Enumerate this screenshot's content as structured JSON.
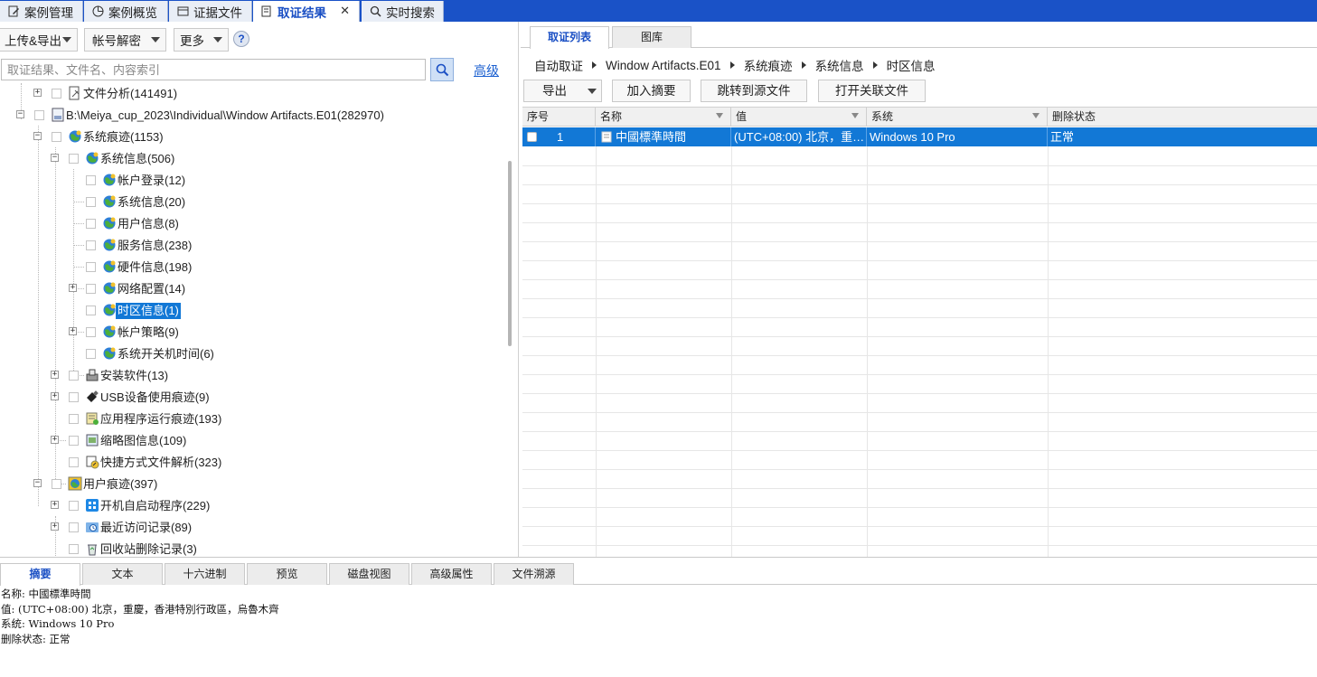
{
  "top_tabs": [
    {
      "label": "案例管理",
      "icon": "edit-icon"
    },
    {
      "label": "案例概览",
      "icon": "pie-chart-icon"
    },
    {
      "label": "证据文件",
      "icon": "document-icon"
    },
    {
      "label": "取证结果",
      "icon": "result-list-icon",
      "active": true,
      "closable": true
    },
    {
      "label": "实时搜索",
      "icon": "search-icon"
    }
  ],
  "left_toolbar": {
    "upload_export": "上传&导出",
    "account_decrypt": "帐号解密",
    "more": "更多",
    "help": "?"
  },
  "search": {
    "placeholder": "取证结果、文件名、内容索引",
    "advanced": "高级"
  },
  "tree": [
    {
      "label": "文件分析(141491)",
      "icon": "file-analysis-icon"
    },
    {
      "label": "B:\\Meiya_cup_2023\\Individual\\Window Artifacts.E01(282970)",
      "icon": "disk-image-icon"
    },
    {
      "label": "系统痕迹(1153)",
      "icon": "globe-icon"
    },
    {
      "label": "系统信息(506)",
      "icon": "globe-icon"
    },
    {
      "label": "帐户登录(12)",
      "icon": "globe-icon"
    },
    {
      "label": "系统信息(20)",
      "icon": "globe-icon"
    },
    {
      "label": "用户信息(8)",
      "icon": "globe-icon"
    },
    {
      "label": "服务信息(238)",
      "icon": "globe-icon"
    },
    {
      "label": "硬件信息(198)",
      "icon": "globe-icon"
    },
    {
      "label": "网络配置(14)",
      "icon": "globe-icon"
    },
    {
      "label": "时区信息(1)",
      "icon": "globe-icon",
      "selected": true
    },
    {
      "label": "帐户策略(9)",
      "icon": "globe-icon"
    },
    {
      "label": "系统开关机时间(6)",
      "icon": "globe-icon"
    },
    {
      "label": "安装软件(13)",
      "icon": "installer-icon"
    },
    {
      "label": "USB设备使用痕迹(9)",
      "icon": "usb-icon"
    },
    {
      "label": "应用程序运行痕迹(193)",
      "icon": "app-run-icon"
    },
    {
      "label": "缩略图信息(109)",
      "icon": "thumbnail-icon"
    },
    {
      "label": "快捷方式文件解析(323)",
      "icon": "shortcut-icon"
    },
    {
      "label": "用户痕迹(397)",
      "icon": "user-trace-icon"
    },
    {
      "label": "开机自启动程序(229)",
      "icon": "startup-icon"
    },
    {
      "label": "最近访问记录(89)",
      "icon": "recent-icon"
    },
    {
      "label": "回收站删除记录(3)",
      "icon": "recycle-bin-icon"
    }
  ],
  "right_tabs": [
    {
      "label": "取证列表",
      "active": true
    },
    {
      "label": "图库"
    }
  ],
  "breadcrumb": [
    "自动取证",
    "Window Artifacts.E01",
    "系统痕迹",
    "系统信息",
    "时区信息"
  ],
  "actions": {
    "export": "导出",
    "add_summary": "加入摘要",
    "jump_source": "跳转到源文件",
    "open_related": "打开关联文件"
  },
  "grid": {
    "headers": [
      "序号",
      "名称",
      "值",
      "系统",
      "删除状态"
    ],
    "rows": [
      {
        "index": "1",
        "name": "中國標準時間",
        "value": "(UTC+08:00) 北京，重慶，香港特別行政區，烏魯木齊",
        "system": "Windows 10 Pro",
        "status": "正常"
      }
    ]
  },
  "bottom_tabs": [
    "摘要",
    "文本",
    "十六进制",
    "预览",
    "磁盘视图",
    "高级属性",
    "文件溯源"
  ],
  "details": [
    "名称: 中國標準時間",
    "值: (UTC+08:00) 北京，重慶，香港特別行政區，烏魯木齊",
    "系统: Windows 10 Pro",
    "删除状态: 正常"
  ],
  "colors": {
    "accent": "#1a52c7",
    "selection": "#1278d6",
    "link": "#1a5fd0"
  }
}
